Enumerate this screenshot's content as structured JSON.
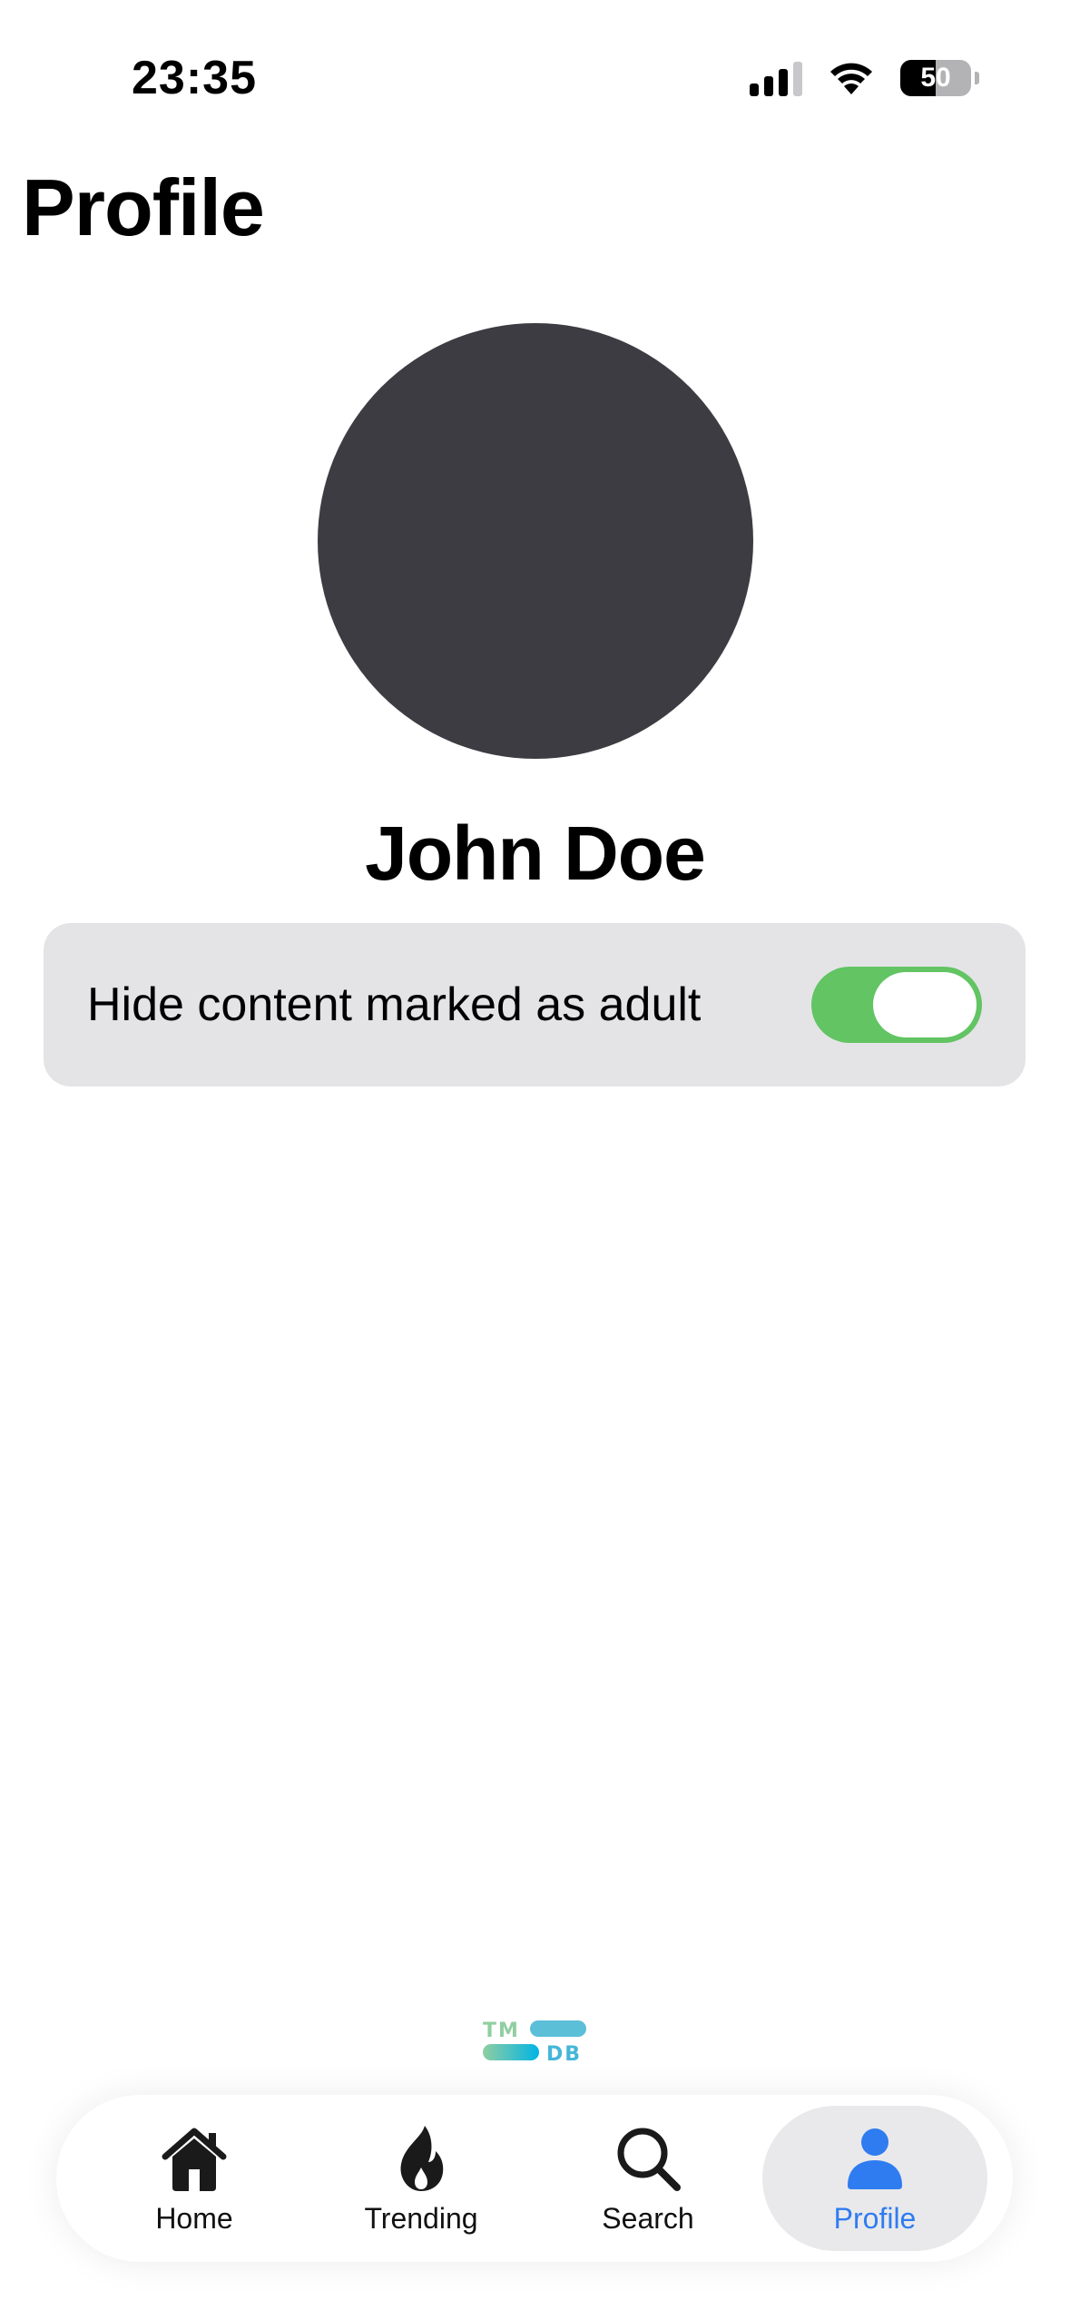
{
  "status_bar": {
    "time": "23:35",
    "battery_level": "50",
    "battery_fraction": 0.5,
    "icons": [
      "cellular-signal-icon",
      "wifi-icon",
      "battery-icon"
    ]
  },
  "header": {
    "title": "Profile"
  },
  "profile": {
    "name": "John Doe",
    "avatar_color": "#3d3c42"
  },
  "settings": {
    "hide_adult": {
      "label": "Hide content marked as adult",
      "enabled": true,
      "on_color": "#62c462"
    }
  },
  "branding": {
    "logo_top": "TM",
    "logo_bottom": "DB"
  },
  "tab_bar": {
    "active_color": "#2f7cf0",
    "items": [
      {
        "label": "Home",
        "icon": "home-icon",
        "active": false
      },
      {
        "label": "Trending",
        "icon": "flame-icon",
        "active": false
      },
      {
        "label": "Search",
        "icon": "search-icon",
        "active": false
      },
      {
        "label": "Profile",
        "icon": "person-icon",
        "active": true
      }
    ]
  }
}
